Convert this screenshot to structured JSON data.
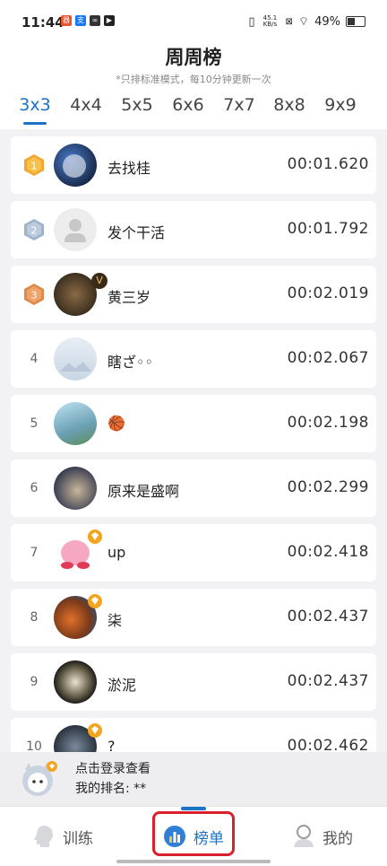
{
  "status": {
    "time": "11:44",
    "net_speed": "45.1 KB/s",
    "battery": "49%"
  },
  "header": {
    "title": "周周榜",
    "subtitle": "*只排标准模式，每10分钟更新一次",
    "tabs": [
      "3x3",
      "4x4",
      "5x5",
      "6x6",
      "7x7",
      "8x8",
      "9x9"
    ],
    "active_tab": "3x3"
  },
  "rankings": [
    {
      "rank": "1",
      "name": "去找桂",
      "time": "00:01.620",
      "vip": false
    },
    {
      "rank": "2",
      "name": "发个干活",
      "time": "00:01.792",
      "vip": false
    },
    {
      "rank": "3",
      "name": "黄三岁",
      "time": "00:02.019",
      "vip": true
    },
    {
      "rank": "4",
      "name": "瞎ざ◦◦",
      "time": "00:02.067",
      "vip": false
    },
    {
      "rank": "5",
      "name": "🏀",
      "time": "00:02.198",
      "vip": false
    },
    {
      "rank": "6",
      "name": "原来是盛啊",
      "time": "00:02.299",
      "vip": false
    },
    {
      "rank": "7",
      "name": "up",
      "time": "00:02.418",
      "vip": true
    },
    {
      "rank": "8",
      "name": "柒",
      "time": "00:02.437",
      "vip": true
    },
    {
      "rank": "9",
      "name": "淤泥",
      "time": "00:02.437",
      "vip": false
    },
    {
      "rank": "10",
      "name": "?",
      "time": "00:02.462",
      "vip": true
    }
  ],
  "me": {
    "login_prompt": "点击登录查看",
    "my_rank": "我的排名: **"
  },
  "nav": {
    "train": "训练",
    "rank": "榜单",
    "mine": "我的"
  },
  "colors": {
    "accent": "#1a73c9",
    "gold": "#f0a630",
    "silver": "#9fb4cc",
    "bronze": "#e08a4a",
    "highlight": "#d91f2c"
  }
}
